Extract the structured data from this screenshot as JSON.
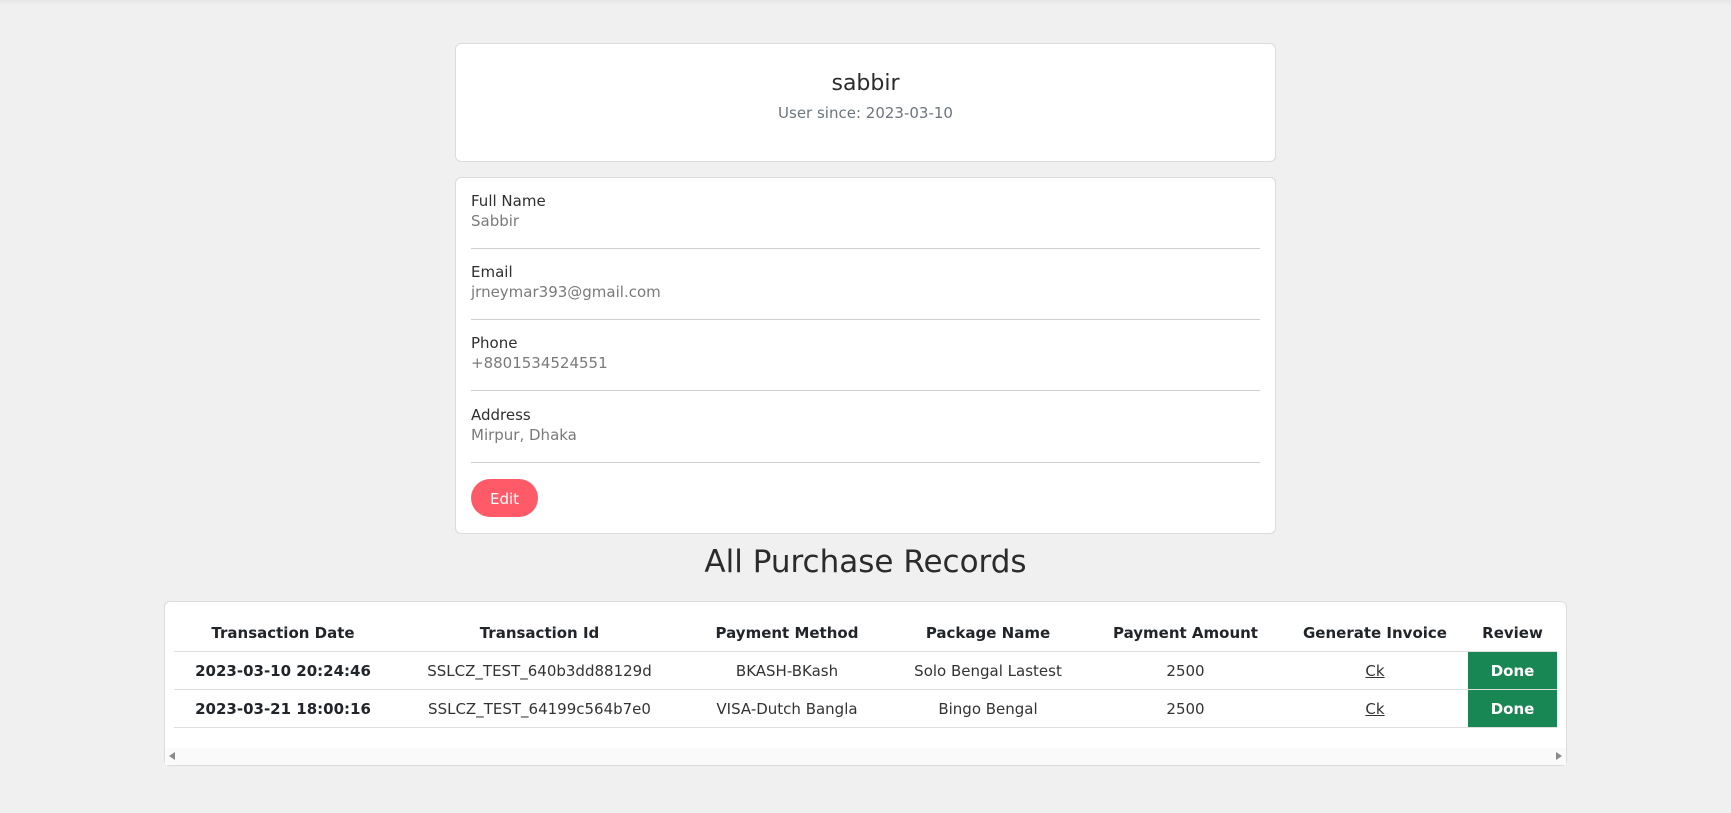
{
  "profile": {
    "username": "sabbir",
    "user_since": "User since: 2023-03-10"
  },
  "details": {
    "full_name_label": "Full Name",
    "full_name_value": "Sabbir",
    "email_label": "Email",
    "email_value": "jrneymar393@gmail.com",
    "phone_label": "Phone",
    "phone_value": "+8801534524551",
    "address_label": "Address",
    "address_value": "Mirpur, Dhaka",
    "edit_label": "Edit"
  },
  "records": {
    "title": "All Purchase Records",
    "headers": [
      "Transaction Date",
      "Transaction Id",
      "Payment Method",
      "Package Name",
      "Payment Amount",
      "Generate Invoice",
      "Review"
    ],
    "rows": [
      [
        "2023-03-10 20:24:46",
        "SSLCZ_TEST_640b3dd88129d",
        "BKASH-BKash",
        "Solo Bengal Lastest",
        "2500",
        "Ck",
        "Done"
      ],
      [
        "2023-03-21 18:00:16",
        "SSLCZ_TEST_64199c564b7e0",
        "VISA-Dutch Bangla",
        "Bingo Bengal",
        "2500",
        "Ck",
        "Done"
      ]
    ]
  },
  "colors": {
    "edit_button": "#ff5a67",
    "done_button": "#198754",
    "background": "#f0f0f0"
  }
}
